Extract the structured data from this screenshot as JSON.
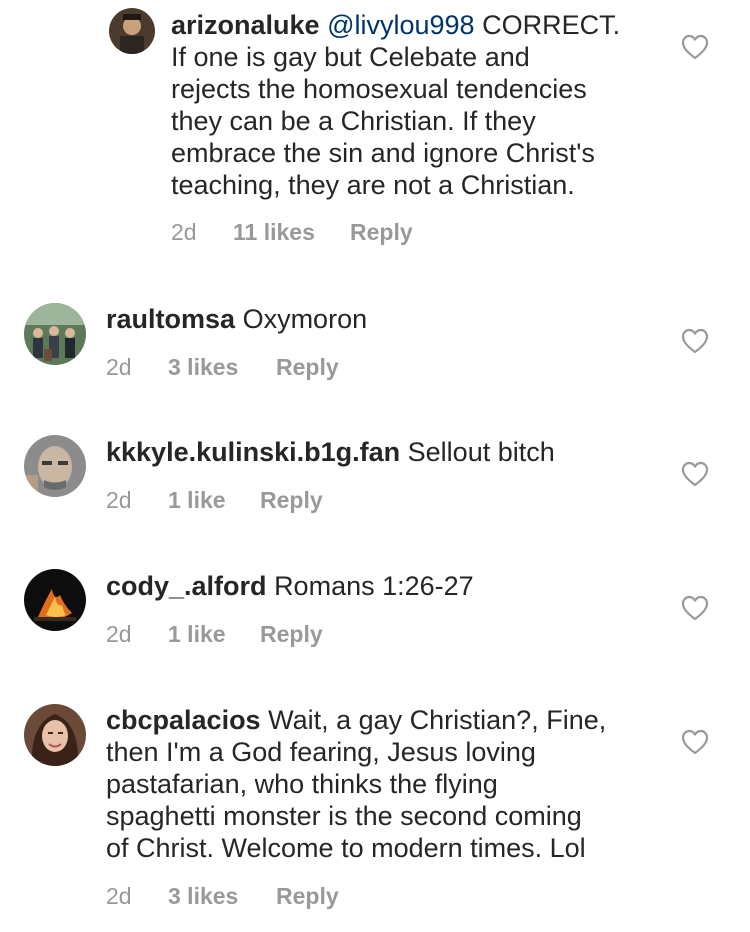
{
  "comments": [
    {
      "username": "arizonaluke",
      "mention": "@livylou998",
      "text_lines": [
        "CORRECT.",
        "If one is gay but Celebate and",
        "rejects the homosexual tendencies",
        "they can be a Christian. If they",
        "embrace the sin and ignore Christ's",
        "teaching, they are not a Christian."
      ],
      "time": "2d",
      "likes": "11 likes",
      "reply": "Reply"
    },
    {
      "username": "raultomsa",
      "text_lines": [
        "Oxymoron"
      ],
      "time": "2d",
      "likes": "3 likes",
      "reply": "Reply"
    },
    {
      "username": "kkkyle.kulinski.b1g.fan",
      "text_lines": [
        "Sellout bitch"
      ],
      "time": "2d",
      "likes": "1 like",
      "reply": "Reply"
    },
    {
      "username": "cody_.alford",
      "text_lines": [
        "Romans 1:26-27"
      ],
      "time": "2d",
      "likes": "1 like",
      "reply": "Reply"
    },
    {
      "username": "cbcpalacios",
      "text_lines": [
        "Wait, a gay Christian?, Fine,",
        "then I'm a God fearing, Jesus loving",
        "pastafarian, who thinks the flying",
        "spaghetti monster is the second coming",
        "of Christ. Welcome to modern times. Lol"
      ],
      "time": "2d",
      "likes": "3 likes",
      "reply": "Reply"
    }
  ],
  "icons": {
    "like": "heart-outline-icon"
  },
  "colors": {
    "text": "#262626",
    "meta": "#999999",
    "mention": "#003569",
    "heart_stroke": "#999999"
  }
}
